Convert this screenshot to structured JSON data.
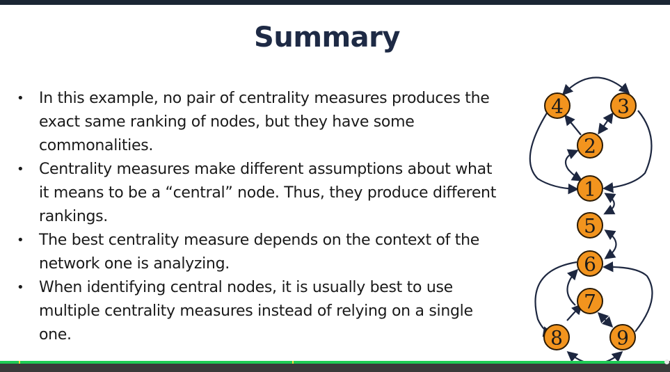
{
  "slide": {
    "title": "Summary",
    "bullets": [
      "In this example, no pair of centrality measures produces the exact same ranking of nodes, but they have some commonalities.",
      "Centrality measures make different assumptions about what it means to be a “central” node.  Thus, they produce different rankings.",
      "The best centrality measure depends on the context of the network one is analyzing.",
      "When identifying central nodes, it is usually best to use multiple centrality measures instead of relying on a single one."
    ],
    "bullet_symbol": "•"
  },
  "graph": {
    "node_color": "#f2941e",
    "edge_color": "#1d2740",
    "nodes": [
      "4",
      "3",
      "2",
      "1",
      "5",
      "6",
      "7",
      "8",
      "9"
    ]
  },
  "player": {
    "progress_color": "#1fcc55",
    "marker_color": "#f6e13a"
  }
}
